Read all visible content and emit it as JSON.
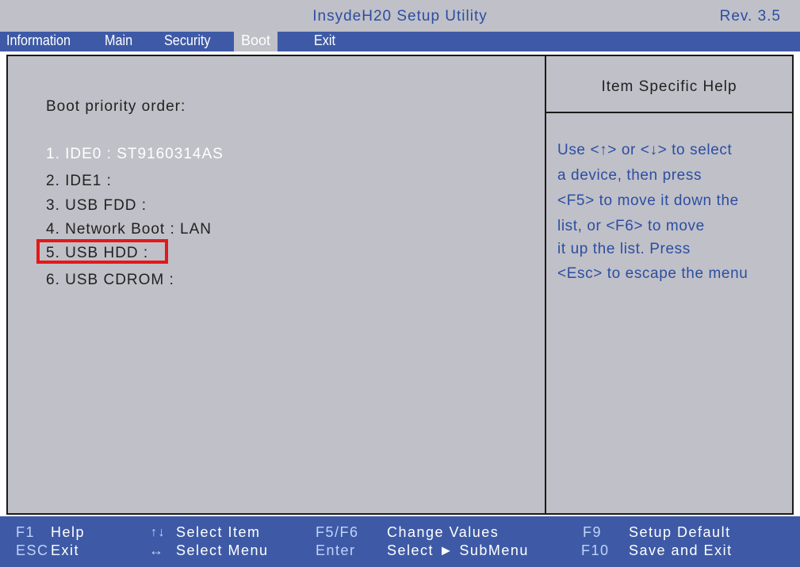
{
  "title": "InsydeH20 Setup Utility",
  "revision": "Rev. 3.5",
  "menu": [
    "Information",
    "Main",
    "Security",
    "Boot",
    "Exit"
  ],
  "active_menu": "Boot",
  "boot": {
    "heading": "Boot priority order:",
    "items": [
      "1. IDE0 : ST9160314AS",
      "2. IDE1 :",
      "3. USB FDD :",
      "4. Network Boot : LAN",
      "5. USB HDD :",
      "6. USB CDROM :"
    ],
    "selected_item": "1. IDE0 : ST9160314AS",
    "highlighted_item": "5. USB HDD :"
  },
  "help": {
    "title": "Item Specific Help",
    "lines": [
      "Use <↑> or <↓> to select",
      "a device, then press",
      "<F5> to move it down the",
      "list, or <F6> to move",
      "it up the list. Press",
      "<Esc> to escape the menu"
    ]
  },
  "footer": {
    "row1": [
      {
        "key": "F1",
        "action": "Help"
      },
      {
        "key": "↑↓",
        "action": "Select  Item"
      },
      {
        "key": "F5/F6",
        "action": "Change  Values"
      },
      {
        "key": "F9",
        "action": "Setup  Default"
      }
    ],
    "row2": [
      {
        "key": "ESC",
        "action": "Exit"
      },
      {
        "key": "↔",
        "action": "Select  Menu"
      },
      {
        "key": "Enter",
        "action": "Select ► SubMenu"
      },
      {
        "key": "F10",
        "action": "Save  and  Exit"
      }
    ]
  },
  "colors": {
    "menubar": "#3e5aa6",
    "panel": "#c0c0c8",
    "highlight": "#e41818",
    "help_text": "#2b4ea2"
  }
}
